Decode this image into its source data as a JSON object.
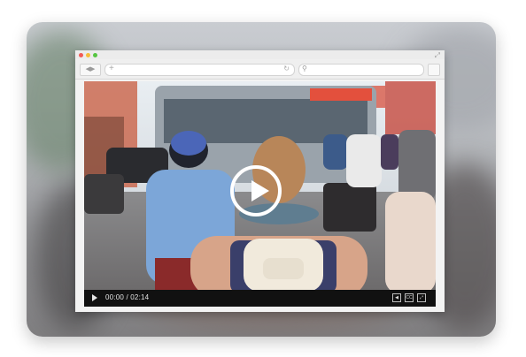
{
  "player": {
    "time_display": "00:00 / 02:14",
    "cc_label": "CC"
  },
  "icons": {
    "back": "chevron-left",
    "forward": "chevron-right",
    "new_tab": "plus",
    "reload": "reload",
    "search": "magnifier",
    "expand": "expand-arrows",
    "play": "play-triangle",
    "volume": "speaker",
    "fullscreen": "fullscreen-arrows"
  },
  "colors": {
    "close_dot": "#f25a55",
    "minimize_dot": "#f6bd3a",
    "maximize_dot": "#55c541",
    "control_bar": "#111111",
    "play_ring": "#ffffff"
  }
}
